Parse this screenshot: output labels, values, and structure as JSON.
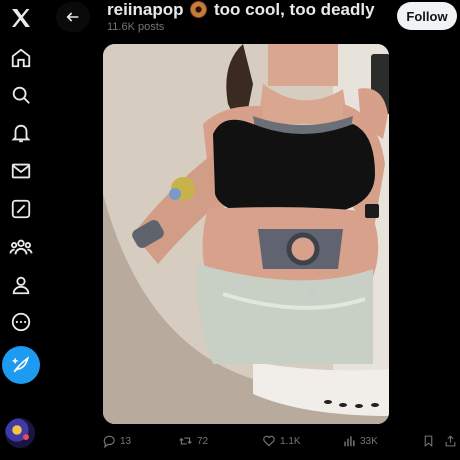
{
  "header": {
    "name": "reiinapop",
    "tagline": "too cool, too deadly",
    "posts_count": "11.6K posts",
    "follow_label": "Follow"
  },
  "nav": {
    "items": [
      {
        "icon": "x-logo-icon"
      },
      {
        "icon": "home-icon"
      },
      {
        "icon": "search-icon"
      },
      {
        "icon": "bell-icon"
      },
      {
        "icon": "envelope-icon"
      },
      {
        "icon": "grok-icon"
      },
      {
        "icon": "communities-icon"
      },
      {
        "icon": "profile-icon"
      },
      {
        "icon": "more-icon"
      }
    ],
    "post_button_icon": "feather-plus-icon"
  },
  "media": {
    "type": "photo"
  },
  "actions": {
    "replies": "13",
    "reposts": "72",
    "likes": "1.1K",
    "views": "33K"
  },
  "colors": {
    "background": "#000000",
    "accent": "#1d9bf0",
    "text_primary": "#e7e9ea",
    "text_secondary": "#71767b",
    "follow_bg": "#eff3f4"
  }
}
